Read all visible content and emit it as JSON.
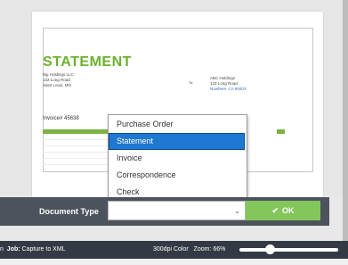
{
  "document": {
    "title": "STATEMENT",
    "sender": [
      "Big Holdings LLC",
      "132 Long Road",
      "Saint Louis, MO"
    ],
    "to_label": "To:",
    "recipient": [
      "ABC Holdings",
      "123 Long Road",
      "Nowhere, CA 90003"
    ],
    "invoice_label": "Invoice# 45638"
  },
  "dropdown": {
    "options": [
      "Purchase Order",
      "Statement",
      "Invoice",
      "Correspondence",
      "Check"
    ],
    "selected": "Statement"
  },
  "action_bar": {
    "label": "Document Type",
    "select_value": "",
    "ok_label": "OK"
  },
  "status_bar": {
    "job_prefix": "n",
    "job_label": "Job:",
    "job_value": "Capture to XML",
    "resolution": "300dpi Color",
    "zoom_label": "Zoom: 66%"
  },
  "colors": {
    "accent_green": "#83c65c",
    "title_green": "#6bb12c",
    "selection_blue": "#1f78d1",
    "bar_dark": "#4d535c"
  }
}
